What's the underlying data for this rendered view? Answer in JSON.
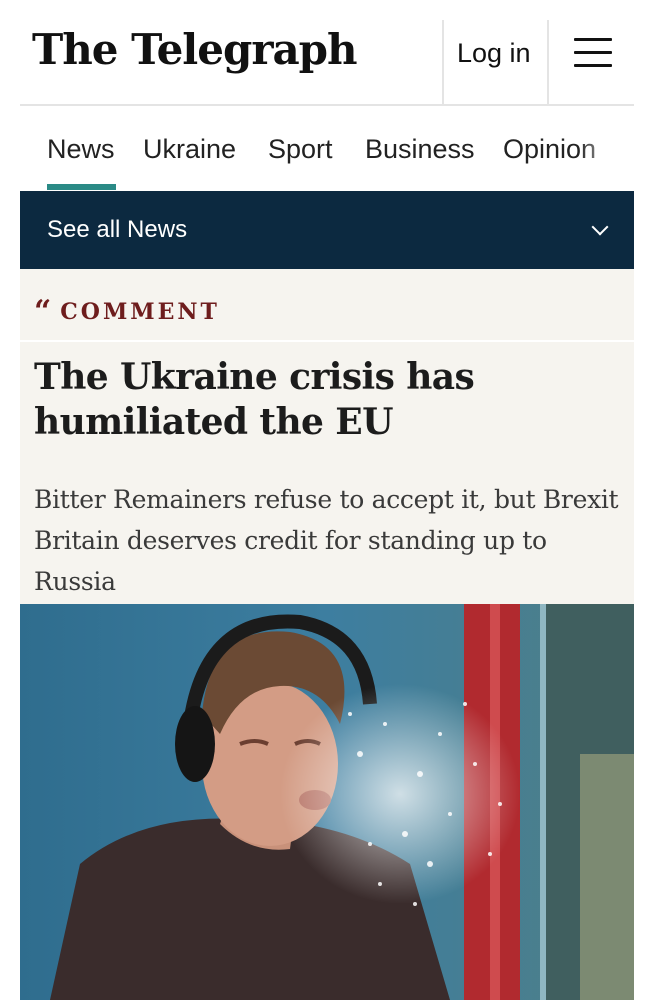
{
  "header": {
    "logo_text": "The Telegraph",
    "login_label": "Log in",
    "menu_icon": "hamburger-menu-icon"
  },
  "nav": {
    "items": [
      {
        "label": "News",
        "active": true
      },
      {
        "label": "Ukraine"
      },
      {
        "label": "Sport"
      },
      {
        "label": "Business"
      },
      {
        "label": "Opinion"
      }
    ],
    "active_color": "#2a8a86"
  },
  "section_bar": {
    "label": "See all News",
    "icon": "chevron-down-icon",
    "background": "#0c2940"
  },
  "article": {
    "kicker_icon": "quote-mark-icon",
    "kicker": "COMMENT",
    "kicker_color": "#6e1d1d",
    "headline": "The Ukraine crisis has humiliated the EU",
    "standfirst": "Bitter Remainers refuse to accept it, but Brexit Britain deserves credit for standing up to Russia",
    "background": "#f6f4ef"
  },
  "photo": {
    "icon": "article-photo"
  }
}
